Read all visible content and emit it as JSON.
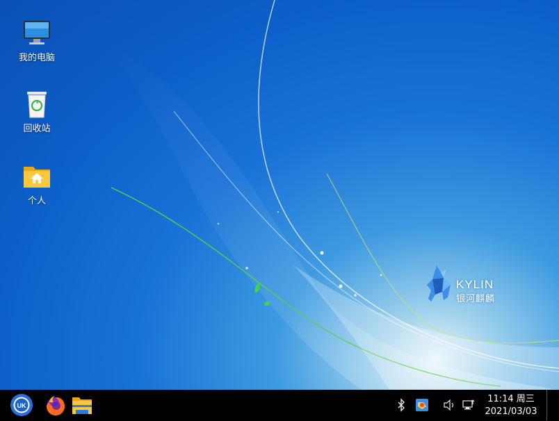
{
  "desktop": {
    "icons": [
      {
        "label": "我的电脑",
        "icon": "computer-icon"
      },
      {
        "label": "回收站",
        "icon": "trash-icon"
      },
      {
        "label": "个人",
        "icon": "home-folder-icon"
      }
    ],
    "logo": {
      "word": "KYLIN",
      "cn": "银河麒麟"
    }
  },
  "taskbar": {
    "start_icon": "kylin-start-icon",
    "apps": [
      "firefox-icon",
      "file-manager-icon"
    ],
    "tray": [
      "bluetooth-icon",
      "kylin-update-icon",
      "volume-icon",
      "network-icon"
    ],
    "clock": {
      "time": "11:14 周三",
      "date": "2021/03/03"
    }
  }
}
